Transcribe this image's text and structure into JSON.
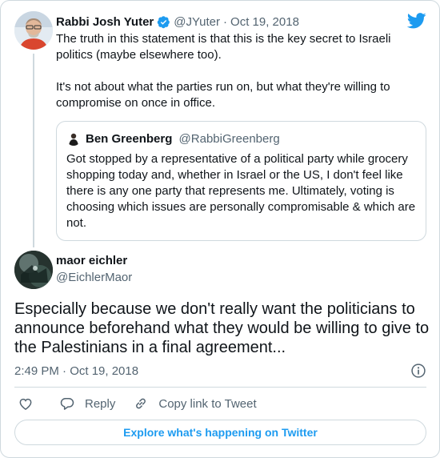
{
  "colors": {
    "accent": "#1d9bf0",
    "text_primary": "#0f1419",
    "text_secondary": "#536471",
    "border": "#cfd9de"
  },
  "icons": {
    "brand": "twitter-bird-icon",
    "verified": "verified-badge-icon",
    "info": "info-icon",
    "like": "heart-icon",
    "reply": "reply-icon",
    "copy_link": "link-icon"
  },
  "parent_tweet": {
    "author_name": "Rabbi Josh Yuter",
    "author_handle": "@JYuter",
    "separator": "·",
    "date": "Oct 19, 2018",
    "text_paragraphs": [
      "The truth in this statement is that this is the key secret to Israeli politics (maybe elsewhere too).",
      "It's not about what the parties run on, but what they're willing to compromise on once in office."
    ],
    "quoted": {
      "author_name": "Ben Greenberg",
      "author_handle": "@RabbiGreenberg",
      "text": "Got stopped by a representative of a political party while grocery shopping today and, whether in Israel or the US, I don't feel like there is any one party that represents me. Ultimately, voting is choosing which issues are personally compromisable & which are not."
    }
  },
  "main_tweet": {
    "author_name": "maor eichler",
    "author_handle": "@EichlerMaor",
    "text": "Especially because we don't really want the politicians to announce beforehand what they would be willing to give to the Palestinians in a final agreement...",
    "timestamp": "2:49 PM · Oct 19, 2018"
  },
  "actions": {
    "reply_label": "Reply",
    "copy_link_label": "Copy link to Tweet"
  },
  "footer": {
    "explore_label": "Explore what's happening on Twitter"
  }
}
